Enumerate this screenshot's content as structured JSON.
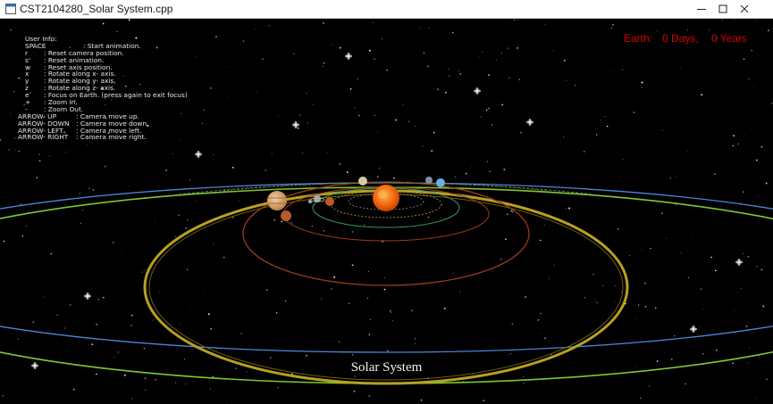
{
  "window": {
    "title": "CST2104280_Solar System.cpp",
    "minimize_label": "minimize",
    "maximize_label": "maximize",
    "close_label": "close"
  },
  "user_info": {
    "heading": "User Info:",
    "keys": [
      {
        "key": "SPACE",
        "desc": ": Start animation."
      },
      {
        "key": "r",
        "desc": ": Reset camera position."
      },
      {
        "key": "s'",
        "desc": ": Reset animation."
      },
      {
        "key": "w",
        "desc": ": Reset axis position."
      },
      {
        "key": "x",
        "desc": ": Rotate along x- axis."
      },
      {
        "key": "y",
        "desc": ": Rotate along y- axis."
      },
      {
        "key": "z",
        "desc": ": Rotate along z- axis."
      },
      {
        "key": "e",
        "desc": ": Focus on Earth. (press again to exit focus)"
      },
      {
        "key": "+",
        "desc": ": Zoom In."
      },
      {
        "key": "-",
        "desc": ": Zoom Out."
      },
      {
        "key": "ARROW- UP",
        "desc": ": Camera move up."
      },
      {
        "key": "ARROW- DOWN",
        "desc": ": Camera move down."
      },
      {
        "key": "ARROW- LEFT",
        "desc": ": Camera move left."
      },
      {
        "key": "ARROW- RIGHT",
        "desc": ": Camera move right."
      }
    ]
  },
  "hud": {
    "planet": "Earth:",
    "days": "0 Days,",
    "years": "0 Years",
    "color": "#d40000"
  },
  "caption": "Solar System",
  "colors": {
    "sky": "#000000",
    "sun": "#f26a10",
    "orbit_blue": "#4a86d8",
    "orbit_green": "#7ec832",
    "orbit_gold": "#b8a020",
    "orbit_red": "#9c3a1c"
  }
}
